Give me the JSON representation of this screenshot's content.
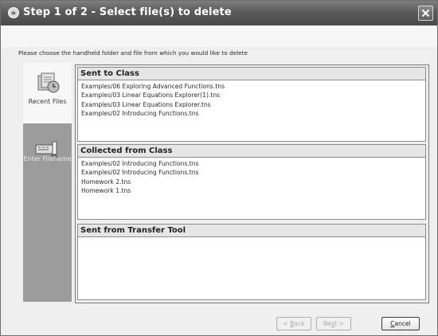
{
  "window": {
    "title": "Step 1 of 2 - Select file(s) to delete"
  },
  "instructions": "Please choose the handheld folder and file from which you would like to delete",
  "sidebar": {
    "items": [
      {
        "label": "Recent Files",
        "icon": "recent-files-icon",
        "active": true
      },
      {
        "label": "Enter Filename",
        "icon": "enter-filename-icon",
        "active": false
      }
    ]
  },
  "sections": [
    {
      "title": "Sent to Class",
      "files": [
        "Examples/06 Exploring Advanced Functions.tns",
        "Examples/03 Linear Equations Explorer(1).tns",
        "Examples/03 Linear Equations Explorer.tns",
        "Examples/02 Introducing Functions.tns"
      ]
    },
    {
      "title": "Collected from Class",
      "files": [
        "Examples/02 Introducing Functions.tns",
        "Examples/02 Introducing Functions.tns",
        "Homework 2.tns",
        "Homework 1.tns"
      ]
    },
    {
      "title": "Sent from Transfer Tool",
      "files": []
    }
  ],
  "footer": {
    "back": {
      "pre": "< ",
      "key": "B",
      "post": "ack",
      "enabled": false
    },
    "next": {
      "pre": "Ne",
      "key": "x",
      "post": "t >",
      "enabled": false
    },
    "cancel": {
      "pre": "",
      "key": "C",
      "post": "ancel",
      "enabled": true
    }
  }
}
